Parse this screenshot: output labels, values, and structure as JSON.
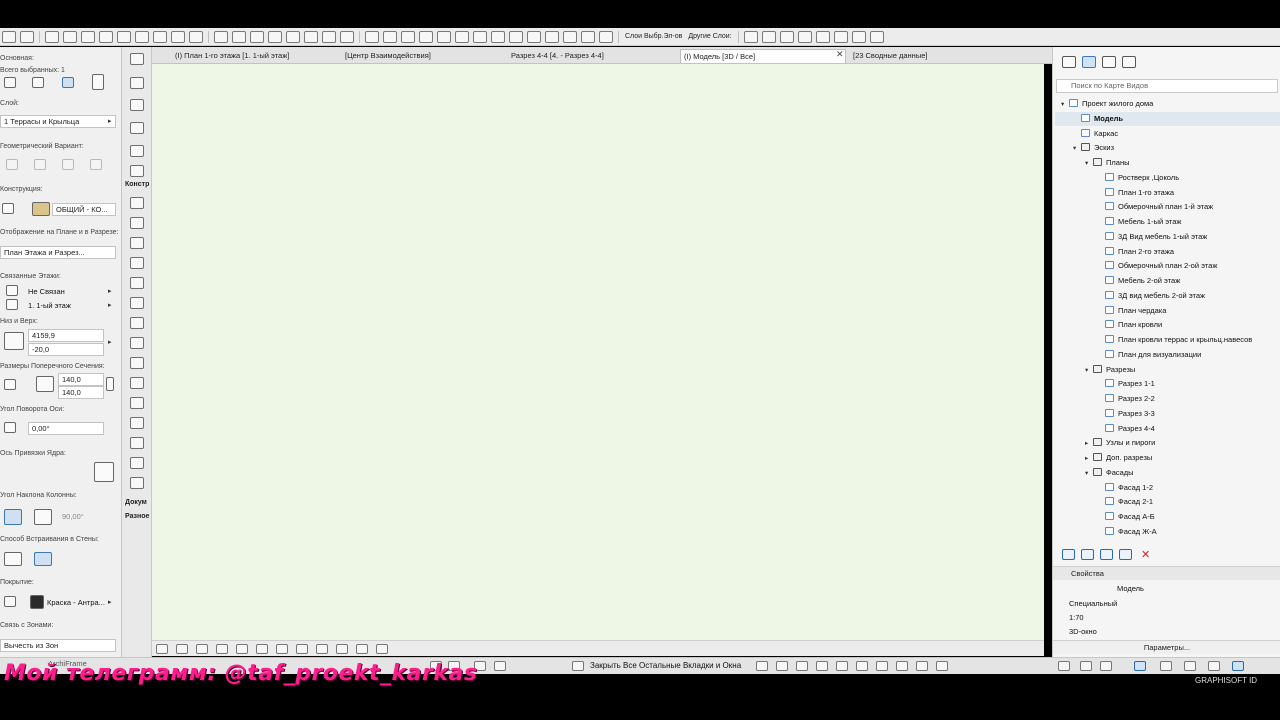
{
  "toolbar": {
    "layers_label": "Слои Выбр.Эл-ов",
    "other_layers_label": "Другие Слои:"
  },
  "infobox": {
    "main_label": "Основная:",
    "selected_count_label": "Всего выбранных: 1",
    "layer_label": "Слой:",
    "layer_value": "1 Террасы и Крыльца",
    "geom_label": "Геометрический Вариант:",
    "construction_label": "Конструкция:",
    "construction_value": "ОБЩИЙ - КО...",
    "display_label": "Отображение на Плане и в Разрезе:",
    "display_value": "План Этажа и Разрез...",
    "linked_floors_label": "Связанные Этажи:",
    "linked_value": "Не Связан",
    "floor_value": "1. 1-ый этаж",
    "bottom_top_label": "Низ и Верх:",
    "top_value": "4159,9",
    "bottom_value": "-20,0",
    "cross_section_label": "Размеры Поперечного Сечения:",
    "width_value": "140,0",
    "depth_value": "140,0",
    "rotation_label": "Угол Поворота Оси:",
    "rotation_value": "0,00°",
    "core_anchor_label": "Ось Привязки Ядра:",
    "slant_label": "Угол Наклона Колонны:",
    "slant_value": "90,00°",
    "wall_embed_label": "Способ Встраивания в Стены:",
    "surface_label": "Покрытие:",
    "surface_value": "Краска - Антра...",
    "zones_label": "Связь с Зонами:",
    "zones_value": "Вычесть из Зон",
    "archiframe": "ArchiFrame"
  },
  "toolbox": {
    "construct_header": "Констр",
    "document_header": "Докум",
    "misc_header": "Разное"
  },
  "tabs": [
    {
      "label": "(I) План 1-го этажа [1. 1-ый этаж]",
      "active": false
    },
    {
      "label": "[Центр Взаимодействия]",
      "active": false
    },
    {
      "label": "Разрез 4-4 [4. - Разрез 4-4]",
      "active": false
    },
    {
      "label": "(I) Модель [3D / Все]",
      "active": true
    },
    {
      "label": "[23 Сводные данные]",
      "active": false
    }
  ],
  "bottombar": {
    "close_all_tabs": "Закрыть Все Остальные Вкладки и Окна",
    "brand": "GRAPHISOFT ID"
  },
  "watermark": {
    "text": "Мой телеграмм: @taf_proekt_karkas"
  },
  "navigator": {
    "search_placeholder": "Поиск по Карте Видов",
    "tree": [
      {
        "label": "Проект жилого дома",
        "level": 0,
        "folder": false,
        "expanded": true,
        "selected": false
      },
      {
        "label": "Модель",
        "level": 1,
        "folder": false,
        "expanded": null,
        "selected": true
      },
      {
        "label": "Каркас",
        "level": 1,
        "folder": false,
        "expanded": null,
        "selected": false
      },
      {
        "label": "Эскиз",
        "level": 1,
        "folder": true,
        "expanded": true,
        "selected": false
      },
      {
        "label": "Планы",
        "level": 2,
        "folder": true,
        "expanded": true,
        "selected": false
      },
      {
        "label": "Ростверк ,Цоколь",
        "level": 3,
        "folder": false,
        "expanded": null,
        "selected": false
      },
      {
        "label": "План 1-го этажа",
        "level": 3,
        "folder": false,
        "expanded": null,
        "selected": false
      },
      {
        "label": "Обмерочный план 1-й этаж",
        "level": 3,
        "folder": false,
        "expanded": null,
        "selected": false
      },
      {
        "label": "Мебель 1-ый этаж",
        "level": 3,
        "folder": false,
        "expanded": null,
        "selected": false
      },
      {
        "label": "3Д Вид мебель 1-ый этаж",
        "level": 3,
        "folder": false,
        "expanded": null,
        "selected": false
      },
      {
        "label": "План 2-го этажа",
        "level": 3,
        "folder": false,
        "expanded": null,
        "selected": false
      },
      {
        "label": "Обмерочный план 2-ой этаж",
        "level": 3,
        "folder": false,
        "expanded": null,
        "selected": false
      },
      {
        "label": "Мебель 2-ой этаж",
        "level": 3,
        "folder": false,
        "expanded": null,
        "selected": false
      },
      {
        "label": "3Д вид мебель 2-ой этаж",
        "level": 3,
        "folder": false,
        "expanded": null,
        "selected": false
      },
      {
        "label": "План чердака",
        "level": 3,
        "folder": false,
        "expanded": null,
        "selected": false
      },
      {
        "label": "План кровли",
        "level": 3,
        "folder": false,
        "expanded": null,
        "selected": false
      },
      {
        "label": "План кровли террас и крыльц.навесов",
        "level": 3,
        "folder": false,
        "expanded": null,
        "selected": false
      },
      {
        "label": "План для визуализации",
        "level": 3,
        "folder": false,
        "expanded": null,
        "selected": false
      },
      {
        "label": "Разрезы",
        "level": 2,
        "folder": true,
        "expanded": true,
        "selected": false
      },
      {
        "label": "Разрез 1-1",
        "level": 3,
        "folder": false,
        "expanded": null,
        "selected": false
      },
      {
        "label": "Разрез 2-2",
        "level": 3,
        "folder": false,
        "expanded": null,
        "selected": false
      },
      {
        "label": "Разрез 3-3",
        "level": 3,
        "folder": false,
        "expanded": null,
        "selected": false
      },
      {
        "label": "Разрез 4-4",
        "level": 3,
        "folder": false,
        "expanded": null,
        "selected": false
      },
      {
        "label": "Узлы и пироги",
        "level": 2,
        "folder": true,
        "expanded": false,
        "selected": false
      },
      {
        "label": "Доп. разрезы",
        "level": 2,
        "folder": true,
        "expanded": false,
        "selected": false
      },
      {
        "label": "Фасады",
        "level": 2,
        "folder": true,
        "expanded": true,
        "selected": false
      },
      {
        "label": "Фасад 1-2",
        "level": 3,
        "folder": false,
        "expanded": null,
        "selected": false
      },
      {
        "label": "Фасад 2-1",
        "level": 3,
        "folder": false,
        "expanded": null,
        "selected": false
      },
      {
        "label": "Фасад А-Б",
        "level": 3,
        "folder": false,
        "expanded": null,
        "selected": false
      },
      {
        "label": "Фасад Ж-А",
        "level": 3,
        "folder": false,
        "expanded": null,
        "selected": false
      }
    ],
    "properties_label": "Свойства",
    "prop_name": "Модель",
    "prop_type": "Специальный",
    "prop_scale": "1:70",
    "prop_view": "3D-окно",
    "params_button": "Параметры..."
  }
}
